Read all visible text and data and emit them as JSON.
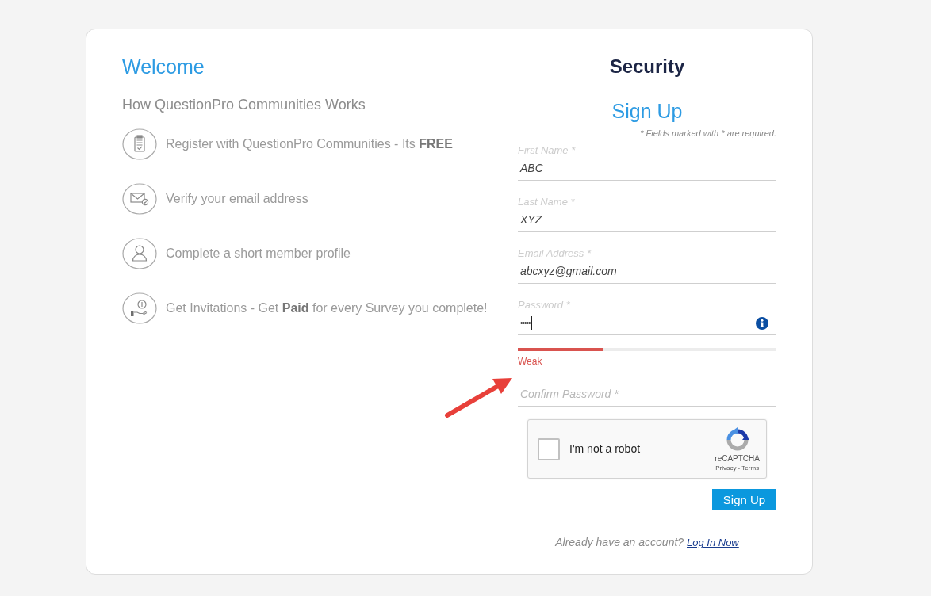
{
  "intro": {
    "title": "Welcome",
    "subtitle": "How QuestionPro Communities Works",
    "steps": [
      {
        "text": "Register with QuestionPro Communities - Its **FREE**"
      },
      {
        "text": "Verify your email address"
      },
      {
        "text": "Complete a short member profile"
      },
      {
        "text": "Get Invitations - Get **Paid** for every Survey you complete!"
      }
    ]
  },
  "form": {
    "heading": "Security",
    "title": "Sign Up",
    "required_note": "* Fields marked with * are required.",
    "fields": [
      {
        "kind": "text",
        "label": "First Name *",
        "value": "ABC",
        "focused": false
      },
      {
        "kind": "text",
        "label": "Last Name *",
        "value": "XYZ",
        "focused": false
      },
      {
        "kind": "text",
        "label": "Email Address *",
        "value": "abcxyz@gmail.com",
        "focused": false
      },
      {
        "kind": "password",
        "label": "Password *",
        "value": "•••••",
        "focused": true,
        "strength": {
          "level": 0.33,
          "label": "Weak"
        }
      },
      {
        "kind": "confirm",
        "placeholder": "Confirm Password *",
        "focused": false
      }
    ],
    "captcha": {
      "label": "I'm not a robot",
      "checked": false,
      "brand": "reCAPTCHA",
      "links": "Privacy - Terms"
    },
    "submit": "Sign Up",
    "login_prompt": {
      "text": "Already have an account?",
      "link": "Log In Now"
    }
  }
}
